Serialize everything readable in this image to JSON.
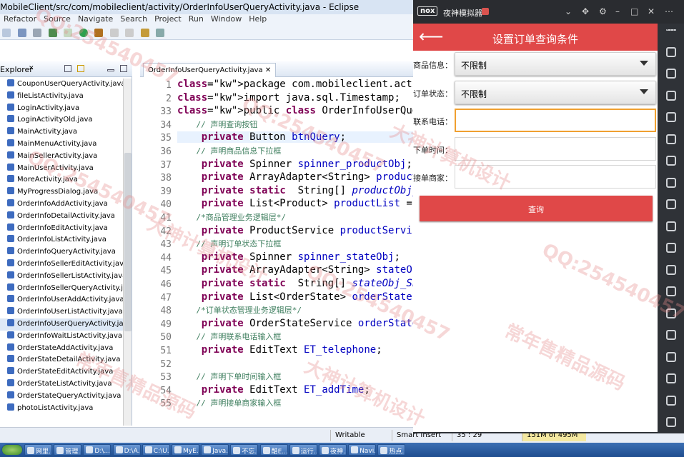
{
  "eclipse": {
    "title": "MobileClient/src/com/mobileclient/activity/OrderInfoUserQueryActivity.java - Eclipse",
    "menu": [
      "Refactor",
      "Source",
      "Navigate",
      "Search",
      "Project",
      "Run",
      "Window",
      "Help"
    ],
    "explorer_tab": "Explorer",
    "files": [
      "CouponUserQueryActivity.java",
      "fileListActivity.java",
      "LoginActivity.java",
      "LoginActivityOld.java",
      "MainActivity.java",
      "MainMenuActivity.java",
      "MainSellerActivity.java",
      "MainUserActivity.java",
      "MoreActivity.java",
      "MyProgressDialog.java",
      "OrderInfoAddActivity.java",
      "OrderInfoDetailActivity.java",
      "OrderInfoEditActivity.java",
      "OrderInfoListActivity.java",
      "OrderInfoQueryActivity.java",
      "OrderInfoSellerEditActivity.java",
      "OrderInfoSellerListActivity.java",
      "OrderInfoSellerQueryActivity.java",
      "OrderInfoUserAddActivity.java",
      "OrderInfoUserListActivity.java",
      "OrderInfoUserQueryActivity.java",
      "OrderInfoWaitListActivity.java",
      "OrderStateAddActivity.java",
      "OrderStateDetailActivity.java",
      "OrderStateEditActivity.java",
      "OrderStateListActivity.java",
      "OrderStateQueryActivity.java",
      "photoListActivity.java"
    ],
    "editor_tab": "OrderInfoUserQueryActivity.java",
    "line_numbers": [
      "1",
      "2",
      "33",
      "34",
      "35",
      "36",
      "37",
      "38",
      "39",
      "40",
      "41",
      "42",
      "43",
      "44",
      "45",
      "46",
      "47",
      "48",
      "49",
      "50",
      "51",
      "52",
      "53",
      "54",
      "55"
    ],
    "code": [
      "package com.mobileclient.activity;",
      "import java.sql.Timestamp;",
      "public class OrderInfoUserQueryActivity",
      "    // 声明查询按钮",
      "    private Button btnQuery;",
      "    // 声明商品信息下拉框",
      "    private Spinner spinner_productObj;",
      "    private ArrayAdapter<String> productOb",
      "    private static  String[] productObj_S",
      "    private List<Product> productList = nu",
      "    /*商品管理业务逻辑层*/",
      "    private ProductService productService",
      "    // 声明订单状态下拉框",
      "    private Spinner spinner_stateObj;",
      "    private ArrayAdapter<String> stateObj_",
      "    private static  String[] stateObj_Sh",
      "    private List<OrderState> orderStateLi",
      "    /*订单状态管理业务逻辑层*/",
      "    private OrderStateService orderStateS",
      "    // 声明联系电话输入框",
      "    private EditText ET_telephone;",
      "",
      "    // 声明下单时间输入框",
      "    private EditText ET_addTime;",
      "    // 声明接单商家输入框"
    ],
    "status": {
      "writable": "Writable",
      "insert": "Smart Insert",
      "position": "35 : 29",
      "memory": "151M of 495M"
    }
  },
  "taskbar": [
    "网里...",
    "管理...",
    "D:\\...",
    "D:\\A...",
    "C:\\U...",
    "MyE...",
    "Java...",
    "不忘...",
    "酷E...",
    "运行...",
    "夜神...",
    "Navi...",
    "热点..."
  ],
  "nox": {
    "logo": "nox",
    "title": "夜神模拟器",
    "app_title": "设置订单查询条件",
    "fields": [
      {
        "label": "商品信息：",
        "type": "spinner",
        "value": "不限制"
      },
      {
        "label": "订单状态：",
        "type": "spinner",
        "value": "不限制"
      },
      {
        "label": "联系电话：",
        "type": "input",
        "value": ""
      },
      {
        "label": "下单时间：",
        "type": "input",
        "value": ""
      },
      {
        "label": "接单商家：",
        "type": "input",
        "value": ""
      }
    ],
    "query_button": "查询"
  },
  "watermarks": [
    "QQ:254540457",
    "大神计算机设计",
    "常年售精品源码"
  ],
  "colors": {
    "accent": "#e04848",
    "focus": "#f0a030",
    "keyword": "#7f0055",
    "comment": "#3f7f5f",
    "field": "#0000c0"
  }
}
